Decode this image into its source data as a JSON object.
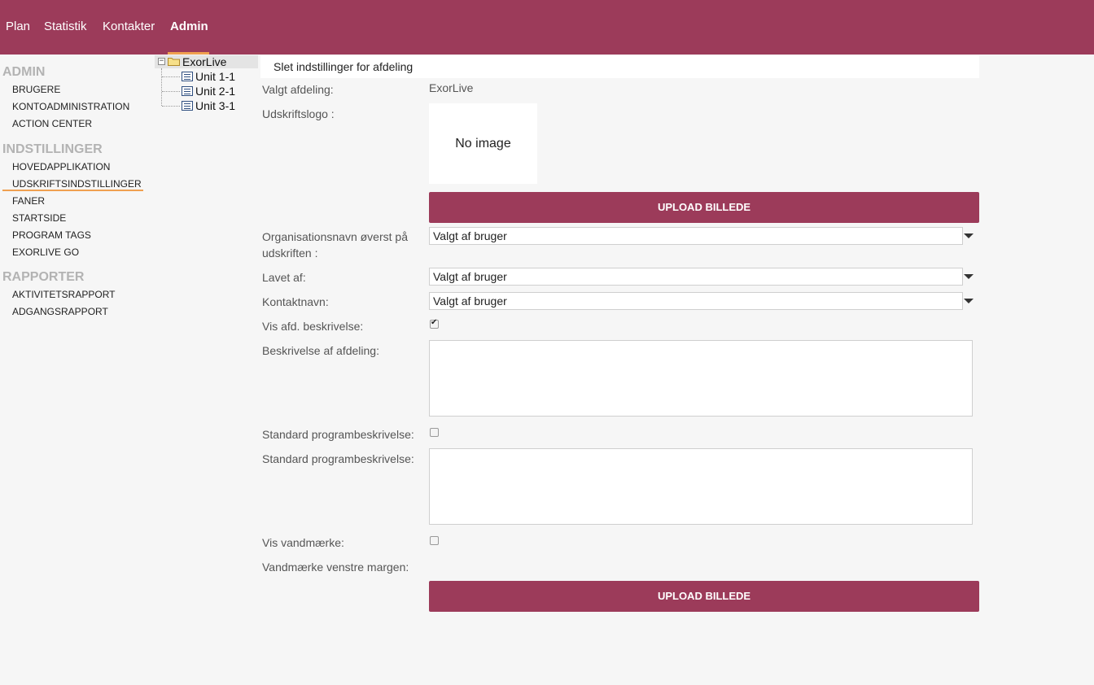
{
  "nav": {
    "items": [
      {
        "label": "Plan"
      },
      {
        "label": "Statistik"
      },
      {
        "label": "Kontakter"
      },
      {
        "label": "Admin"
      }
    ],
    "active": "Admin",
    "accent_color": "#9c3b5a",
    "underline_color": "#f0a050"
  },
  "sidebar": {
    "admin_heading": "ADMIN",
    "admin_items": [
      "BRUGERE",
      "KONTOADMINISTRATION",
      "ACTION CENTER"
    ],
    "settings_heading": "INDSTILLINGER",
    "settings_items": [
      "HOVEDAPPLIKATION",
      "UDSKRIFTSINDSTILLINGER",
      "FANER",
      "STARTSIDE",
      "PROGRAM TAGS",
      "EXORLIVE GO"
    ],
    "reports_heading": "RAPPORTER",
    "reports_items": [
      "AKTIVITETSRAPPORT",
      "ADGANGSRAPPORT"
    ],
    "active_item": "UDSKRIFTSINDSTILLINGER"
  },
  "tree": {
    "root": "ExorLive",
    "children": [
      "Unit 1-1",
      "Unit 2-1",
      "Unit 3-1"
    ]
  },
  "panel": {
    "header": "Slet indstillinger for afdeling",
    "selected_dept_label": "Valgt afdeling:",
    "selected_dept_value": "ExorLive",
    "logo_label": "Udskriftslogo :",
    "logo_placeholder": "No image",
    "upload_button": "UPLOAD BILLEDE",
    "org_name_label": "Organisationsnavn øverst på udskriften :",
    "org_name_value": "Valgt af bruger",
    "made_by_label": "Lavet af:",
    "made_by_value": "Valgt af bruger",
    "contact_label": "Kontaktnavn:",
    "contact_value": "Valgt af bruger",
    "show_desc_label": "Vis afd. beskrivelse:",
    "show_desc_checked": true,
    "desc_label": "Beskrivelse af afdeling:",
    "std_prog_check_label": "Standard programbeskrivelse:",
    "std_prog_checked": false,
    "std_prog_text_label": "Standard programbeskrivelse:",
    "watermark_label": "Vis vandmærke:",
    "watermark_checked": false,
    "watermark_margin_label": "Vandmærke venstre margen:",
    "upload_button_2": "UPLOAD BILLEDE"
  }
}
